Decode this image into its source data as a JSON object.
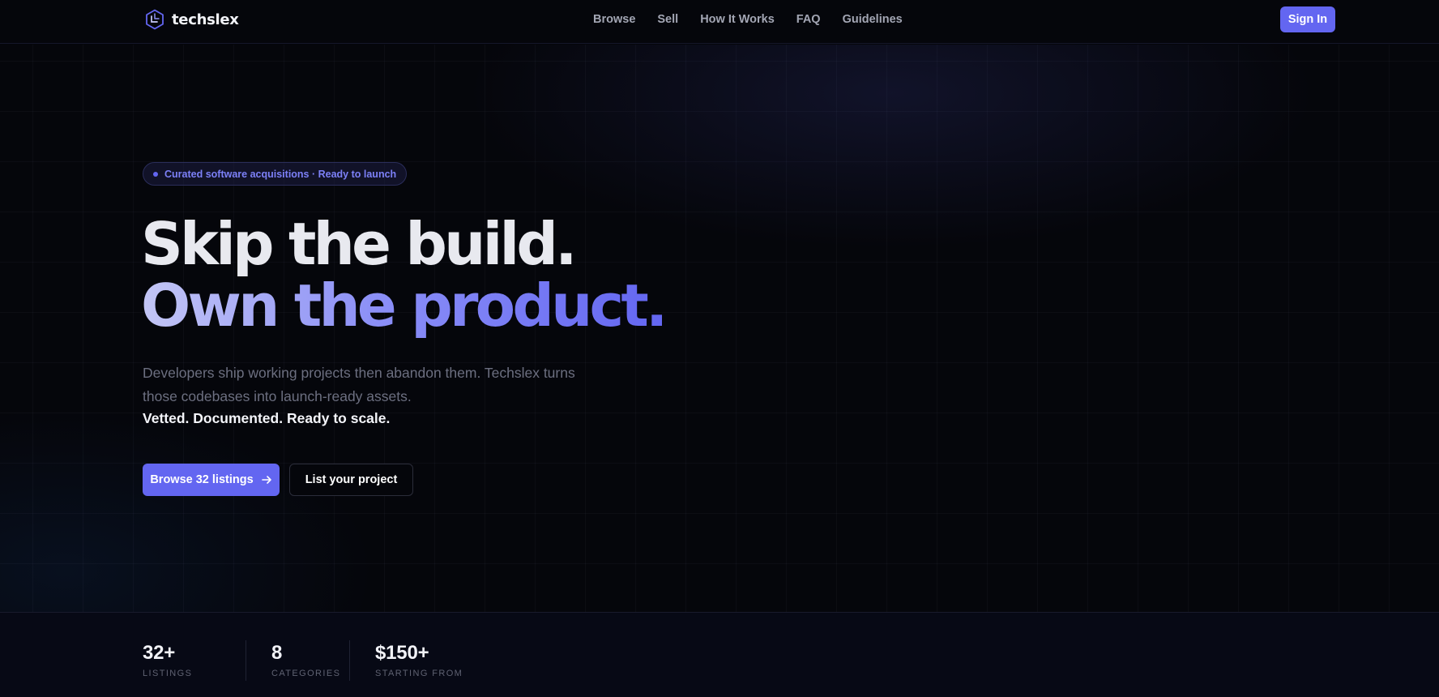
{
  "header": {
    "brand": "techslex",
    "nav": [
      {
        "label": "Browse"
      },
      {
        "label": "Sell"
      },
      {
        "label": "How It Works"
      },
      {
        "label": "FAQ"
      },
      {
        "label": "Guidelines"
      }
    ],
    "signin_label": "Sign In"
  },
  "hero": {
    "badge": "Curated software acquisitions · Ready to launch",
    "headline_line1": "Skip the build.",
    "headline_line2": "Own the product.",
    "lead": "Developers ship working projects then abandon them. Techslex turns those codebases into launch-ready assets.",
    "tagline": "Vetted. Documented. Ready to scale.",
    "cta_primary": "Browse 32 listings",
    "cta_secondary": "List your project"
  },
  "stats": [
    {
      "value": "32+",
      "label": "LISTINGS"
    },
    {
      "value": "8",
      "label": "CATEGORIES"
    },
    {
      "value": "$150+",
      "label": "STARTING FROM"
    }
  ],
  "colors": {
    "accent": "#6366f1",
    "background": "#05060b",
    "headline_light": "#e8e9ef",
    "headline_gradient_start": "#c3c6f5",
    "muted_text": "#6c6f80"
  },
  "icons": {
    "logo": "cube-logo-icon",
    "cta_arrow": "arrow-right-icon"
  }
}
